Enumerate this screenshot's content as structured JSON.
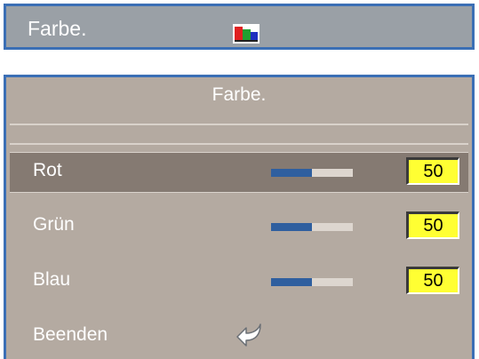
{
  "header": {
    "title": "Farbe.",
    "icon": "color-bars-icon"
  },
  "menu": {
    "title": "Farbe.",
    "items": [
      {
        "label": "Rot",
        "value": "50",
        "level": 0.5,
        "selected": true
      },
      {
        "label": "Grün",
        "value": "50",
        "level": 0.5,
        "selected": false
      },
      {
        "label": "Blau",
        "value": "50",
        "level": 0.5,
        "selected": false
      }
    ],
    "exit": {
      "label": "Beenden",
      "icon": "return-arrow-icon"
    }
  },
  "colors": {
    "border": "#3b6fb5",
    "panel": "#b4aaa1",
    "selected_row": "#857a72",
    "value_box": "#ffff33",
    "slider_fill": "#2f5f9f"
  }
}
